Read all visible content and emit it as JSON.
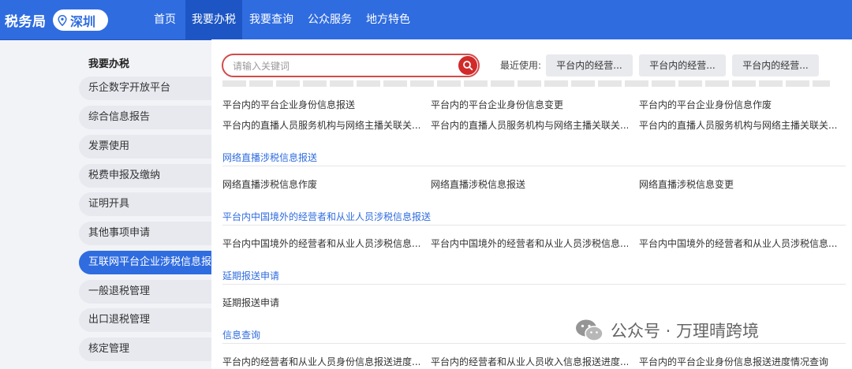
{
  "header": {
    "brand": "税务局",
    "city": "深圳",
    "nav": [
      {
        "label": "首页"
      },
      {
        "label": "我要办税"
      },
      {
        "label": "我要查询"
      },
      {
        "label": "公众服务"
      },
      {
        "label": "地方特色"
      }
    ],
    "active_index": 1
  },
  "sidebar": {
    "title": "我要办税",
    "items": [
      {
        "label": "乐企数字开放平台"
      },
      {
        "label": "综合信息报告"
      },
      {
        "label": "发票使用"
      },
      {
        "label": "税费申报及缴纳"
      },
      {
        "label": "证明开具"
      },
      {
        "label": "其他事项申请"
      },
      {
        "label": "互联网平台企业涉税信息报送"
      },
      {
        "label": "一般退税管理"
      },
      {
        "label": "出口退税管理"
      },
      {
        "label": "核定管理"
      }
    ],
    "active_index": 6
  },
  "search": {
    "placeholder": "请输入关键词",
    "value": ""
  },
  "recent": {
    "label": "最近使用:",
    "chips": [
      "平台内的经营...",
      "平台内的经营...",
      "平台内的经营..."
    ]
  },
  "content": {
    "rows_top": [
      [
        "平台内的平台企业身份信息报送",
        "平台内的平台企业身份信息变更",
        "平台内的平台企业身份信息作废"
      ],
      [
        "平台内的直播人员服务机构与网络主播关联关...",
        "平台内的直播人员服务机构与网络主播关联关...",
        "平台内的直播人员服务机构与网络主播关联关..."
      ]
    ],
    "sections": [
      {
        "title": "网络直播涉税信息报送",
        "links": [
          "网络直播涉税信息作废",
          "网络直播涉税信息报送",
          "网络直播涉税信息变更"
        ]
      },
      {
        "title": "平台内中国境外的经营者和从业人员涉税信息报送",
        "links": [
          "平台内中国境外的经营者和从业人员涉税信息...",
          "平台内中国境外的经营者和从业人员涉税信息...",
          "平台内中国境外的经营者和从业人员涉税信息..."
        ]
      },
      {
        "title": "延期报送申请",
        "links": [
          "延期报送申请"
        ]
      },
      {
        "title": "信息查询",
        "links": [
          "平台内的经营者和从业人员身份信息报送进度...",
          "平台内的经营者和从业人员收入信息报送进度...",
          "平台内的平台企业身份信息报送进度情况查询"
        ]
      }
    ]
  },
  "watermark": {
    "text": "公众号 · 万理晴跨境"
  },
  "colors": {
    "primary": "#2f6ce0",
    "nav_active": "#1d56c4",
    "search_border": "#d24b4b",
    "search_button": "#d22a2a"
  }
}
